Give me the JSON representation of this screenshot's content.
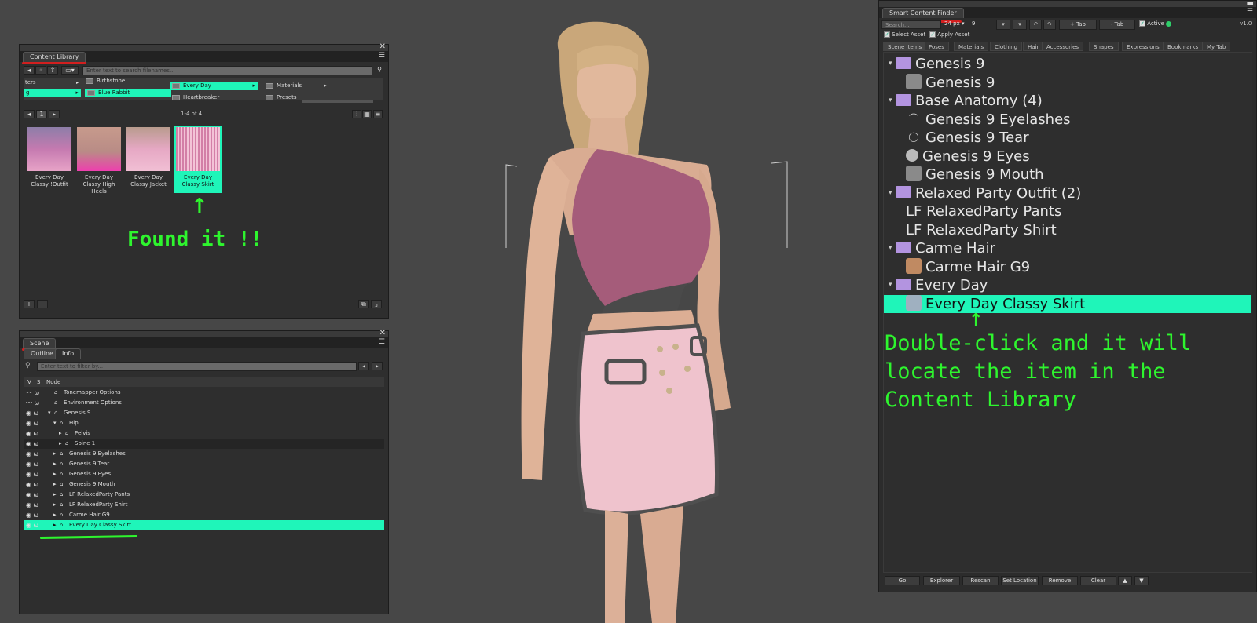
{
  "content_library": {
    "title": "Content Library",
    "search_placeholder": "Enter text to search filenames...",
    "columns": {
      "col1": [
        "ters",
        "g"
      ],
      "col2": [
        "Birthstone",
        "Blue Rabbit"
      ],
      "col3": [
        "Every Day",
        "Heartbreaker"
      ],
      "col4": [
        "Materials",
        "Presets"
      ]
    },
    "page_num": "1",
    "count": "1-4 of 4",
    "thumbs": [
      {
        "label": "Every Day Classy !Outfit"
      },
      {
        "label": "Every Day Classy High Heels"
      },
      {
        "label": "Every Day Classy Jacket"
      },
      {
        "label": "Every Day Classy Skirt"
      }
    ],
    "add_label": "+",
    "remove_label": "−",
    "annotation": "Found it !!",
    "arrow": "↑"
  },
  "scene": {
    "title": "Scene",
    "tabs": [
      "Outline",
      "Info"
    ],
    "filter_placeholder": "Enter text to filter by...",
    "headers": {
      "v": "V",
      "s": "S",
      "node": "Node"
    },
    "rows": [
      {
        "label": "Tonemapper Options",
        "indent": 0
      },
      {
        "label": "Environment Options",
        "indent": 0
      },
      {
        "label": "Genesis 9",
        "indent": 0,
        "caret": "▾"
      },
      {
        "label": "Hip",
        "indent": 1,
        "caret": "▾"
      },
      {
        "label": "Pelvis",
        "indent": 2,
        "caret": "▸"
      },
      {
        "label": "Spine 1",
        "indent": 2,
        "caret": "▸"
      },
      {
        "label": "Genesis 9 Eyelashes",
        "indent": 1,
        "caret": "▸"
      },
      {
        "label": "Genesis 9 Tear",
        "indent": 1,
        "caret": "▸"
      },
      {
        "label": "Genesis 9 Eyes",
        "indent": 1,
        "caret": "▸"
      },
      {
        "label": "Genesis 9 Mouth",
        "indent": 1,
        "caret": "▸"
      },
      {
        "label": "LF RelaxedParty Pants",
        "indent": 1,
        "caret": "▸"
      },
      {
        "label": "LF RelaxedParty Shirt",
        "indent": 1,
        "caret": "▸"
      },
      {
        "label": "Carme Hair G9",
        "indent": 1,
        "caret": "▸"
      },
      {
        "label": "Every Day Classy Skirt",
        "indent": 1,
        "caret": "▸",
        "selected": true
      }
    ]
  },
  "smart_finder": {
    "title": "Smart Content Finder",
    "search_placeholder": "Search...",
    "size": "24 px",
    "size_num": "9",
    "add_tab": "+ Tab",
    "remove_tab": "- Tab",
    "active_label": "Active",
    "version": "v1.0",
    "select_asset": "Select Asset",
    "apply_asset": "Apply Asset",
    "tabs": [
      "Scene Items",
      "Poses",
      "Materials",
      "Clothing",
      "Hair",
      "Accessories",
      "Shapes",
      "Expressions",
      "Bookmarks",
      "My Tab"
    ],
    "tree": [
      {
        "label": "Genesis 9",
        "type": "folder"
      },
      {
        "label": "Genesis 9",
        "type": "item",
        "icon": "figure-icon"
      },
      {
        "label": "Base Anatomy (4)",
        "type": "folder"
      },
      {
        "label": "Genesis 9 Eyelashes",
        "type": "item",
        "icon": "eyelash-icon"
      },
      {
        "label": "Genesis 9 Tear",
        "type": "item",
        "icon": "tear-icon"
      },
      {
        "label": "Genesis 9 Eyes",
        "type": "item",
        "icon": "eye-icon"
      },
      {
        "label": "Genesis 9 Mouth",
        "type": "item",
        "icon": "mouth-icon"
      },
      {
        "label": "Relaxed Party Outfit (2)",
        "type": "folder"
      },
      {
        "label": "LF RelaxedParty Pants",
        "type": "plain"
      },
      {
        "label": "LF RelaxedParty Shirt",
        "type": "plain"
      },
      {
        "label": "Carme Hair",
        "type": "folder"
      },
      {
        "label": "Carme Hair G9",
        "type": "item",
        "icon": "hair-thumb-icon"
      },
      {
        "label": "Every Day",
        "type": "folder"
      },
      {
        "label": "Every Day Classy Skirt",
        "type": "item",
        "icon": "skirt-thumb-icon",
        "selected": true
      }
    ],
    "annotation": "Double-click and it will\nlocate the item in the\nContent Library",
    "buttons": [
      "Go",
      "Explorer",
      "Rescan",
      "Set Location",
      "Remove",
      "Clear",
      "▲",
      "▼"
    ]
  },
  "colors": {
    "highlight": "#1ff5b9",
    "annotation": "#2ef52e",
    "folder": "#b394e0",
    "mark": "#d21f1f"
  }
}
